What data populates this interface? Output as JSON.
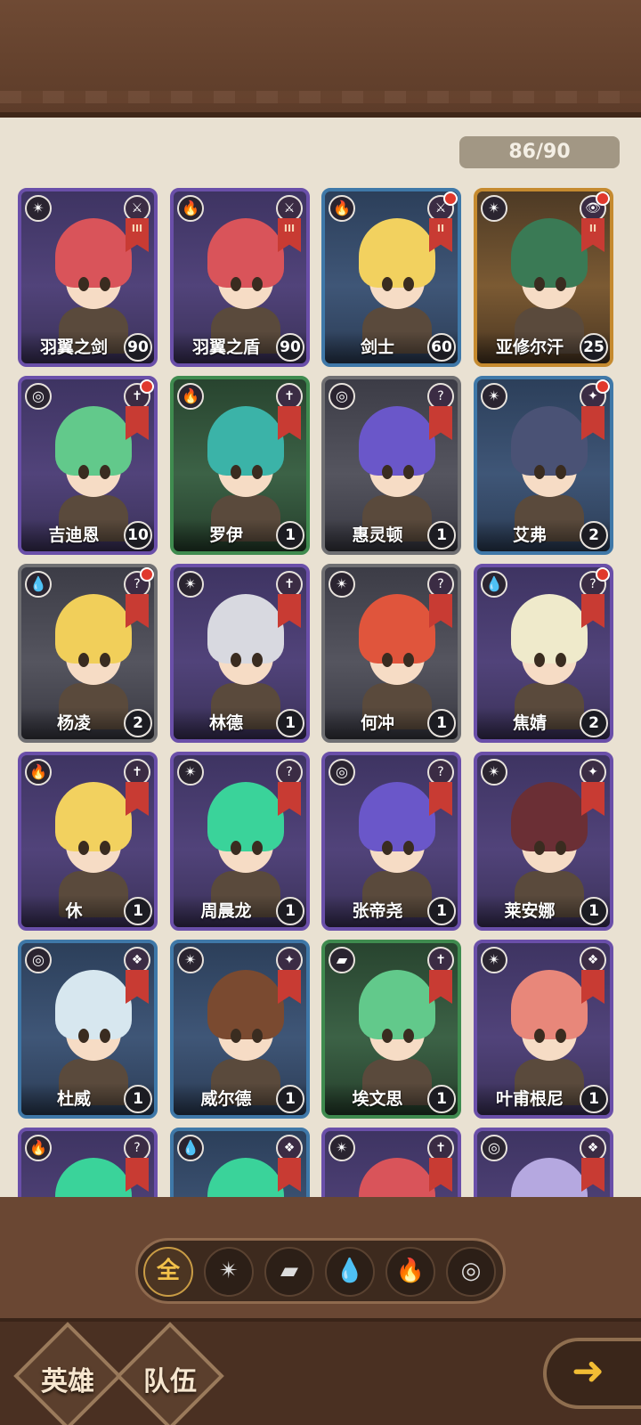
{
  "collection": {
    "count": "86/90"
  },
  "heroes": [
    {
      "name": "羽翼之剑",
      "level": "90",
      "element": "wind-icon",
      "element_glyph": "✴",
      "class_glyph": "⚔",
      "rank": "III",
      "frame": "purple",
      "hair": "#d9545a",
      "red_dot": false
    },
    {
      "name": "羽翼之盾",
      "level": "90",
      "element": "fire-icon",
      "element_glyph": "🔥",
      "class_glyph": "⚔",
      "rank": "III",
      "frame": "purple",
      "hair": "#d9545a",
      "red_dot": false
    },
    {
      "name": "剑士",
      "level": "60",
      "element": "fire-icon",
      "element_glyph": "🔥",
      "class_glyph": "⚔",
      "rank": "II",
      "frame": "blue",
      "hair": "#f2d15f",
      "red_dot": true
    },
    {
      "name": "亚修尔汗",
      "level": "25",
      "element": "wind-icon",
      "element_glyph": "✴",
      "class_glyph": "👁",
      "rank": "II",
      "frame": "gold",
      "hair": "#3a7a55",
      "red_dot": true
    },
    {
      "name": "吉迪恩",
      "level": "10",
      "element": "nature-icon",
      "element_glyph": "◎",
      "class_glyph": "✝",
      "rank": "",
      "frame": "purple",
      "hair": "#62c98b",
      "red_dot": true
    },
    {
      "name": "罗伊",
      "level": "1",
      "element": "fire-icon",
      "element_glyph": "🔥",
      "class_glyph": "✝",
      "rank": "",
      "frame": "green",
      "hair": "#3bb3a8",
      "red_dot": false
    },
    {
      "name": "惠灵顿",
      "level": "1",
      "element": "nature-icon",
      "element_glyph": "◎",
      "class_glyph": "?",
      "rank": "",
      "frame": "grey",
      "hair": "#6a57c9",
      "red_dot": false
    },
    {
      "name": "艾弗",
      "level": "2",
      "element": "wind-icon",
      "element_glyph": "✴",
      "class_glyph": "✦",
      "rank": "",
      "frame": "blue",
      "hair": "#4a5275",
      "red_dot": true
    },
    {
      "name": "杨凌",
      "level": "2",
      "element": "water-icon",
      "element_glyph": "💧",
      "class_glyph": "?",
      "rank": "",
      "frame": "grey",
      "hair": "#f1cf5a",
      "red_dot": true
    },
    {
      "name": "林德",
      "level": "1",
      "element": "wind-icon",
      "element_glyph": "✴",
      "class_glyph": "✝",
      "rank": "",
      "frame": "purple",
      "hair": "#d8d9e0",
      "red_dot": false
    },
    {
      "name": "何冲",
      "level": "1",
      "element": "wind-icon",
      "element_glyph": "✴",
      "class_glyph": "?",
      "rank": "",
      "frame": "grey",
      "hair": "#e0553c",
      "red_dot": false
    },
    {
      "name": "焦婧",
      "level": "2",
      "element": "water-icon",
      "element_glyph": "💧",
      "class_glyph": "?",
      "rank": "",
      "frame": "purple",
      "hair": "#efeacb",
      "red_dot": true
    },
    {
      "name": "休",
      "level": "1",
      "element": "fire-icon",
      "element_glyph": "🔥",
      "class_glyph": "✝",
      "rank": "",
      "frame": "purple",
      "hair": "#f2d15f",
      "red_dot": false
    },
    {
      "name": "周晨龙",
      "level": "1",
      "element": "wind-icon",
      "element_glyph": "✴",
      "class_glyph": "?",
      "rank": "",
      "frame": "purple",
      "hair": "#3ad39a",
      "red_dot": false
    },
    {
      "name": "张帝尧",
      "level": "1",
      "element": "nature-icon",
      "element_glyph": "◎",
      "class_glyph": "?",
      "rank": "",
      "frame": "purple",
      "hair": "#6a57c9",
      "red_dot": false
    },
    {
      "name": "莱安娜",
      "level": "1",
      "element": "wind-icon",
      "element_glyph": "✴",
      "class_glyph": "✦",
      "rank": "",
      "frame": "purple",
      "hair": "#6b2f35",
      "red_dot": false
    },
    {
      "name": "杜威",
      "level": "1",
      "element": "nature-icon",
      "element_glyph": "◎",
      "class_glyph": "❖",
      "rank": "",
      "frame": "blue",
      "hair": "#d7e7ef",
      "red_dot": false
    },
    {
      "name": "威尔德",
      "level": "1",
      "element": "wind-icon",
      "element_glyph": "✴",
      "class_glyph": "✦",
      "rank": "",
      "frame": "blue",
      "hair": "#7a4a30",
      "red_dot": false
    },
    {
      "name": "埃文思",
      "level": "1",
      "element": "earth-icon",
      "element_glyph": "▰",
      "class_glyph": "✝",
      "rank": "",
      "frame": "green",
      "hair": "#62c98b",
      "red_dot": false
    },
    {
      "name": "叶甫根尼",
      "level": "1",
      "element": "wind-icon",
      "element_glyph": "✴",
      "class_glyph": "❖",
      "rank": "",
      "frame": "purple",
      "hair": "#e8877a",
      "red_dot": false
    },
    {
      "name": "",
      "level": "",
      "element": "fire-icon",
      "element_glyph": "🔥",
      "class_glyph": "?",
      "rank": "",
      "frame": "purple",
      "hair": "#3ad39a",
      "red_dot": false
    },
    {
      "name": "",
      "level": "",
      "element": "water-icon",
      "element_glyph": "💧",
      "class_glyph": "❖",
      "rank": "",
      "frame": "blue",
      "hair": "#3ad39a",
      "red_dot": false
    },
    {
      "name": "",
      "level": "",
      "element": "wind-icon",
      "element_glyph": "✴",
      "class_glyph": "✝",
      "rank": "",
      "frame": "purple",
      "hair": "#d9545a",
      "red_dot": false
    },
    {
      "name": "",
      "level": "",
      "element": "nature-icon",
      "element_glyph": "◎",
      "class_glyph": "❖",
      "rank": "",
      "frame": "purple",
      "hair": "#b5a8e0",
      "red_dot": false
    }
  ],
  "filters": [
    {
      "label": "全",
      "icon": "all-icon",
      "active": true
    },
    {
      "label": "✴",
      "icon": "wind-icon",
      "active": false
    },
    {
      "label": "▰",
      "icon": "earth-icon",
      "active": false
    },
    {
      "label": "💧",
      "icon": "water-icon",
      "active": false
    },
    {
      "label": "🔥",
      "icon": "fire-icon",
      "active": false
    },
    {
      "label": "◎",
      "icon": "nature-icon",
      "active": false
    }
  ],
  "nav": {
    "heroes_label": "英雄",
    "team_label": "队伍",
    "next_icon": "arrow-right-icon",
    "next_glyph": "➜"
  }
}
